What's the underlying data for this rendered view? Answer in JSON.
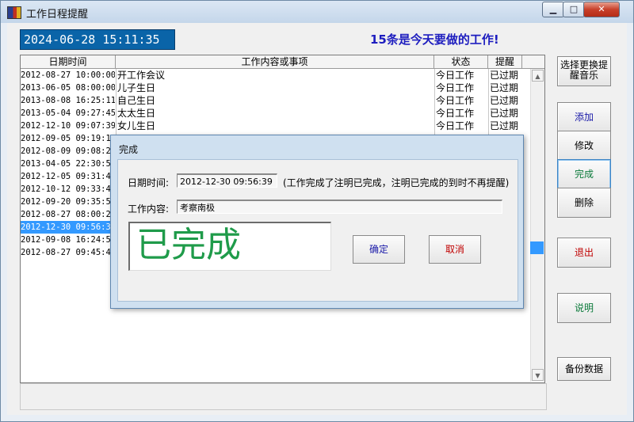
{
  "window": {
    "title": "工作日程提醒"
  },
  "header": {
    "clock": "2024-06-28 15:11:35",
    "headline": "15条是今天要做的工作!"
  },
  "list": {
    "columns": [
      "日期时间",
      "工作内容或事项",
      "状态",
      "提醒"
    ],
    "rows": [
      {
        "dt": "2012-08-27 10:00:00",
        "content": "开工作会议",
        "status": "今日工作",
        "remind": "已过期"
      },
      {
        "dt": "2013-06-05 08:00:00",
        "content": "儿子生日",
        "status": "今日工作",
        "remind": "已过期"
      },
      {
        "dt": "2013-08-08 16:25:11",
        "content": "自己生日",
        "status": "今日工作",
        "remind": "已过期"
      },
      {
        "dt": "2013-05-04 09:27:45",
        "content": "太太生日",
        "status": "今日工作",
        "remind": "已过期"
      },
      {
        "dt": "2012-12-10 09:07:39",
        "content": "女儿生日",
        "status": "今日工作",
        "remind": "已过期"
      },
      {
        "dt": "2012-09-05 09:19:19",
        "content": "",
        "status": "",
        "remind": ""
      },
      {
        "dt": "2012-08-09 09:08:25",
        "content": "",
        "status": "",
        "remind": ""
      },
      {
        "dt": "2013-04-05 22:30:53",
        "content": "",
        "status": "",
        "remind": ""
      },
      {
        "dt": "2012-12-05 09:31:48",
        "content": "",
        "status": "",
        "remind": ""
      },
      {
        "dt": "2012-10-12 09:33:42",
        "content": "",
        "status": "",
        "remind": ""
      },
      {
        "dt": "2012-09-20 09:35:57",
        "content": "",
        "status": "",
        "remind": ""
      },
      {
        "dt": "2012-08-27 08:00:29",
        "content": "",
        "status": "",
        "remind": ""
      },
      {
        "dt": "2012-12-30 09:56:39",
        "content": "",
        "status": "",
        "remind": ""
      },
      {
        "dt": "2012-09-08 16:24:52",
        "content": "",
        "status": "",
        "remind": ""
      },
      {
        "dt": "2012-08-27 09:45:45",
        "content": "",
        "status": "",
        "remind": ""
      }
    ],
    "selected_index": 12
  },
  "buttons": {
    "music": "选择更换提醒音乐",
    "add": "添加",
    "edit": "修改",
    "done": "完成",
    "delete": "删除",
    "exit": "退出",
    "help": "说明",
    "backup": "备份数据"
  },
  "dialog": {
    "title": "完成",
    "datetime_label": "日期时间:",
    "datetime_value": "2012-12-30 09:56:39",
    "note": "(工作完成了注明已完成，注明已完成的到时不再提醒)",
    "content_label": "工作内容:",
    "content_value": "考察南极",
    "big_text": "已完成",
    "ok": "确定",
    "cancel": "取消"
  },
  "colors": {
    "clock_bg": "#0a64a8",
    "headline": "#1d1dbf",
    "done_text": "#1f9b4a",
    "selection": "#3399ff"
  }
}
